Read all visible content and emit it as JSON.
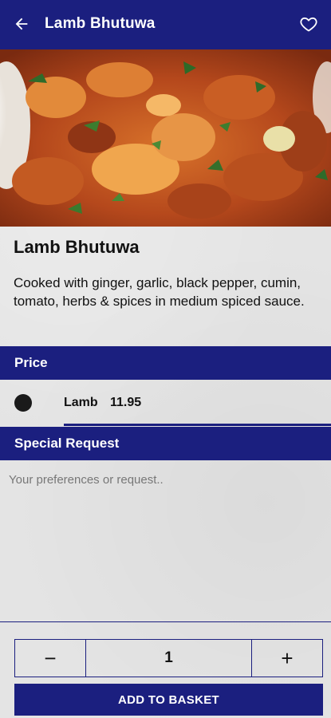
{
  "header": {
    "title": "Lamb Bhutuwa",
    "back_icon": "arrow-left-icon",
    "favorite_icon": "heart-outline-icon"
  },
  "dish": {
    "image_alt": "lamb bhutuwa dish",
    "title": "Lamb Bhutuwa",
    "description": "Cooked with ginger, garlic, black pepper, cumin, tomato, herbs & spices in medium spiced sauce."
  },
  "price_section": {
    "heading": "Price",
    "options": [
      {
        "name": "Lamb",
        "price": "11.95",
        "selected": true
      }
    ]
  },
  "special_request": {
    "heading": "Special Request",
    "placeholder": "Your preferences or request..",
    "value": ""
  },
  "quantity": {
    "minus_label": "−",
    "value": "1",
    "plus_label": "+"
  },
  "actions": {
    "add_to_basket": "ADD TO BASKET"
  },
  "colors": {
    "primary": "#1b1f7f",
    "background": "#e4e4e4",
    "text": "#111111"
  }
}
